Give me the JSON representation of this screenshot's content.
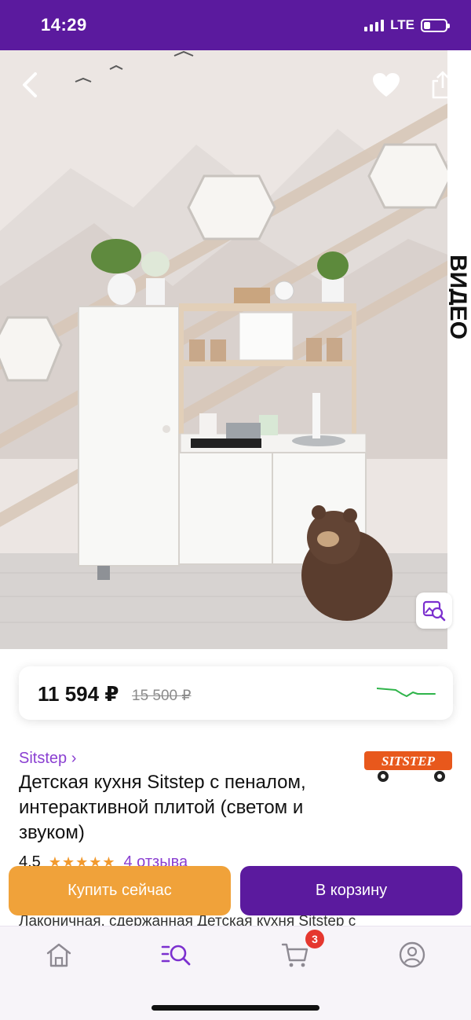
{
  "status_bar": {
    "time": "14:29",
    "network": "LTE"
  },
  "product_image": {
    "alt": "Детская кухня Sitstep",
    "side_text": "ВИДЕО"
  },
  "price": {
    "current": "11 594 ₽",
    "old": "15 500 ₽"
  },
  "product": {
    "brand": "Sitstep ›",
    "logo_text": "SITSTEP",
    "title": "Детская кухня Sitstep с пеналом, интерактивной плитой (светом и звуком)",
    "rating": "4.5",
    "stars": "★★★★★",
    "reviews": "4 отзыва",
    "description_peek": "Лаконичная, сдержанная Детская кухня Sitstep с"
  },
  "actions": {
    "buy_now": "Купить сейчас",
    "add_to_cart": "В корзину"
  },
  "tab_bar": {
    "cart_badge": "3",
    "icons": [
      "home-icon",
      "catalog-search-icon",
      "cart-icon",
      "profile-icon"
    ]
  },
  "colors": {
    "brand_purple": "#5b1a9e",
    "accent_orange": "#f0a23a",
    "link_purple": "#8a3fd1",
    "badge_red": "#e5372f",
    "trend_green": "#2fb44a"
  }
}
